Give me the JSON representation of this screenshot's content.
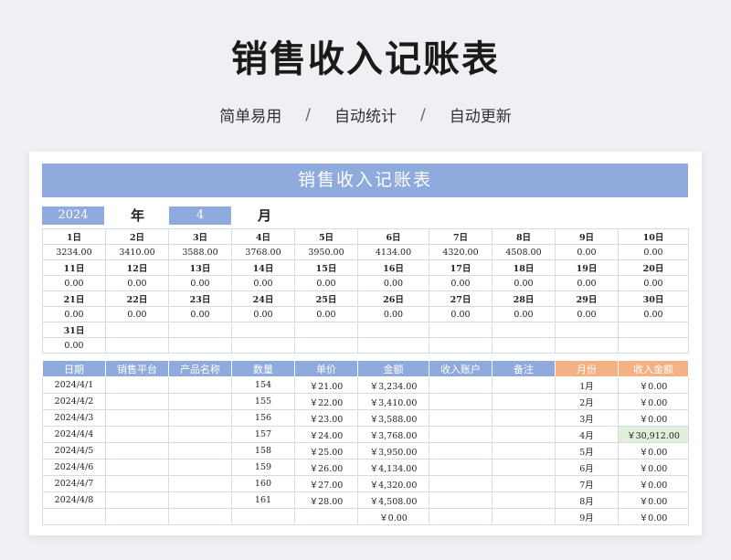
{
  "page": {
    "title": "销售收入记账表",
    "features": [
      "简单易用",
      "自动统计",
      "自动更新"
    ],
    "separator": "/"
  },
  "sheet": {
    "banner": "销售收入记账表",
    "year_value": "2024",
    "year_label": "年",
    "month_value": "4",
    "month_label": "月"
  },
  "calendar": {
    "rows": [
      {
        "days": [
          "1日",
          "2日",
          "3日",
          "4日",
          "5日",
          "6日",
          "7日",
          "8日",
          "9日",
          "10日"
        ],
        "values": [
          "3234.00",
          "3410.00",
          "3588.00",
          "3768.00",
          "3950.00",
          "4134.00",
          "4320.00",
          "4508.00",
          "0.00",
          "0.00"
        ]
      },
      {
        "days": [
          "11日",
          "12日",
          "13日",
          "14日",
          "15日",
          "16日",
          "17日",
          "18日",
          "19日",
          "20日"
        ],
        "values": [
          "0.00",
          "0.00",
          "0.00",
          "0.00",
          "0.00",
          "0.00",
          "0.00",
          "0.00",
          "0.00",
          "0.00"
        ]
      },
      {
        "days": [
          "21日",
          "22日",
          "23日",
          "24日",
          "25日",
          "26日",
          "27日",
          "28日",
          "29日",
          "30日"
        ],
        "values": [
          "0.00",
          "0.00",
          "0.00",
          "0.00",
          "0.00",
          "0.00",
          "0.00",
          "0.00",
          "0.00",
          "0.00"
        ]
      },
      {
        "days": [
          "31日",
          "",
          "",
          "",
          "",
          "",
          "",
          "",
          "",
          ""
        ],
        "values": [
          "0.00",
          "",
          "",
          "",
          "",
          "",
          "",
          "",
          "",
          ""
        ]
      }
    ]
  },
  "ledger": {
    "headers": [
      "日期",
      "销售平台",
      "产品名称",
      "数量",
      "单价",
      "金额",
      "收入账户",
      "备注",
      "月份",
      "收入金额"
    ],
    "rows": [
      [
        "2024/4/1",
        "",
        "",
        "154",
        "￥21.00",
        "￥3,234.00",
        "",
        "",
        "1月",
        "￥0.00"
      ],
      [
        "2024/4/2",
        "",
        "",
        "155",
        "￥22.00",
        "￥3,410.00",
        "",
        "",
        "2月",
        "￥0.00"
      ],
      [
        "2024/4/3",
        "",
        "",
        "156",
        "￥23.00",
        "￥3,588.00",
        "",
        "",
        "3月",
        "￥0.00"
      ],
      [
        "2024/4/4",
        "",
        "",
        "157",
        "￥24.00",
        "￥3,768.00",
        "",
        "",
        "4月",
        "￥30,912.00"
      ],
      [
        "2024/4/5",
        "",
        "",
        "158",
        "￥25.00",
        "￥3,950.00",
        "",
        "",
        "5月",
        "￥0.00"
      ],
      [
        "2024/4/6",
        "",
        "",
        "159",
        "￥26.00",
        "￥4,134.00",
        "",
        "",
        "6月",
        "￥0.00"
      ],
      [
        "2024/4/7",
        "",
        "",
        "160",
        "￥27.00",
        "￥4,320.00",
        "",
        "",
        "7月",
        "￥0.00"
      ],
      [
        "2024/4/8",
        "",
        "",
        "161",
        "￥28.00",
        "￥4,508.00",
        "",
        "",
        "8月",
        "￥0.00"
      ],
      [
        "",
        "",
        "",
        "",
        "",
        "￥0.00",
        "",
        "",
        "9月",
        "￥0.00"
      ]
    ]
  },
  "colors": {
    "header_blue": "#8faadc",
    "header_orange": "#f4b183",
    "highlight_green": "#e2efda"
  }
}
